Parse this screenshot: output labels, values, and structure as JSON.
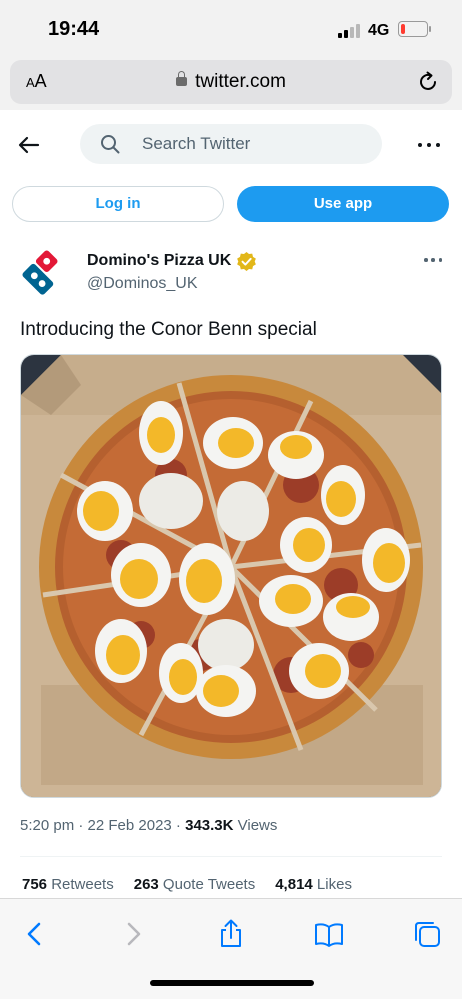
{
  "status_bar": {
    "time": "19:44",
    "network": "4G",
    "battery_level": 0.15
  },
  "browser": {
    "aa_label_large": "A",
    "aa_label_small": "A",
    "url": "twitter.com"
  },
  "header": {
    "search_placeholder": "Search Twitter"
  },
  "auth": {
    "login_label": "Log in",
    "use_app_label": "Use app"
  },
  "tweet": {
    "author_name": "Domino's Pizza UK",
    "author_handle": "@Dominos_UK",
    "text": "Introducing the Conor Benn special",
    "time": "5:20 pm · 22 Feb 2023 · ",
    "views_count": "343.3K",
    "views_label": " Views",
    "retweets_count": "756",
    "retweets_label": " Retweets",
    "quotes_count": "263",
    "quotes_label": " Quote Tweets",
    "likes_count": "4,814",
    "likes_label": " Likes"
  },
  "colors": {
    "twitter_blue": "#1d9bf0",
    "dominos_blue": "#006491",
    "dominos_red": "#e31837",
    "verified_gold": "#e2b719",
    "safari_blue": "#007aff"
  },
  "icons": {
    "back": "arrow-left-icon",
    "search": "magnifier-icon",
    "more": "ellipsis-icon",
    "verified": "verified-badge-icon",
    "share": "share-icon",
    "bookmarks": "book-icon",
    "tabs": "tabs-icon"
  }
}
